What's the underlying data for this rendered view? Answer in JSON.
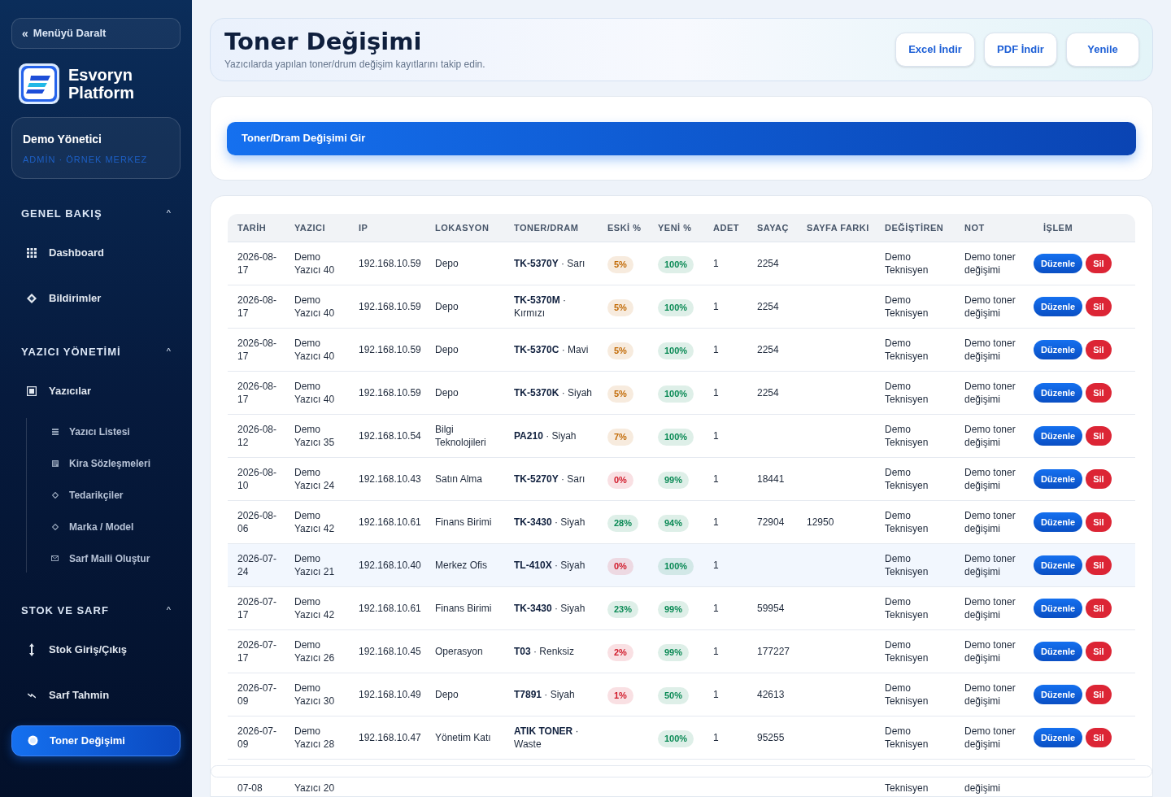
{
  "sidebar": {
    "collapse_button": {
      "icon": "«",
      "label": "Menüyü Daralt"
    },
    "brand": {
      "line1": "Esvoryn",
      "line2": "Platform"
    },
    "user": {
      "name": "Demo Yönetici",
      "role": "ADMİN · ÖRNEK MERKEZ"
    },
    "sections": [
      {
        "title": "GENEL BAKIŞ",
        "toggle": "^",
        "expanded": true,
        "items": [
          {
            "label": "Dashboard",
            "selected": false
          },
          {
            "label": "Bildirimler",
            "selected": false
          }
        ]
      },
      {
        "title": "YAZICI YÖNETİMİ",
        "toggle": "^",
        "expanded": true,
        "items": [
          {
            "label": "Yazıcılar",
            "selected": false,
            "children": [
              {
                "label": "Yazıcı Listesi"
              },
              {
                "label": "Kira Sözleşmeleri"
              },
              {
                "label": "Tedarikçiler"
              },
              {
                "label": "Marka / Model"
              },
              {
                "label": "Sarf Maili Oluştur"
              }
            ]
          }
        ]
      },
      {
        "title": "STOK VE SARF",
        "toggle": "^",
        "expanded": true,
        "items": [
          {
            "label": "Stok Giriş/Çıkış",
            "selected": false
          },
          {
            "label": "Sarf Tahmin",
            "selected": false
          },
          {
            "label": "Toner Değişimi",
            "selected": true
          }
        ]
      }
    ]
  },
  "header": {
    "title": "Toner Değişimi",
    "subtitle": "Yazıcılarda yapılan toner/drum değişim kayıtlarını takip edin.",
    "buttons": [
      "Excel İndir",
      "PDF İndir",
      "Yenile"
    ]
  },
  "entry_button": "Toner/Dram Değişimi Gir",
  "table": {
    "columns": [
      "TARİH",
      "YAZICI",
      "IP",
      "LOKASYON",
      "TONER/DRAM",
      "ESKİ %",
      "YENİ %",
      "ADET",
      "SAYAÇ",
      "SAYFA FARKI",
      "DEĞİŞTİREN",
      "NOT",
      "İŞLEM"
    ],
    "rows": [
      {
        "date": "2026-08-17",
        "printer": "Demo Yazıcı 40",
        "ip": "192.168.10.59",
        "location": "Depo",
        "toner_model": "TK-5370Y",
        "toner_color": "· Sarı",
        "old": {
          "text": "5%",
          "color": "#c26a05"
        },
        "new": {
          "text": "100%",
          "color": "#0a8a55"
        },
        "qty": "1",
        "counter": "2254",
        "changer": "Demo Teknisyen",
        "note": "Demo toner değişimi",
        "actions": [
          "Düzenle",
          "Sil"
        ],
        "highlighted": false
      },
      {
        "date": "2026-08-17",
        "printer": "Demo Yazıcı 40",
        "ip": "192.168.10.59",
        "location": "Depo",
        "toner_model": "TK-5370M",
        "toner_color": "· Kırmızı",
        "old": {
          "text": "5%",
          "color": "#c26a05"
        },
        "new": {
          "text": "100%",
          "color": "#0a8a55"
        },
        "qty": "1",
        "counter": "2254",
        "changer": "Demo Teknisyen",
        "note": "Demo toner değişimi",
        "actions": [
          "Düzenle",
          "Sil"
        ],
        "highlighted": false
      },
      {
        "date": "2026-08-17",
        "printer": "Demo Yazıcı 40",
        "ip": "192.168.10.59",
        "location": "Depo",
        "toner_model": "TK-5370C",
        "toner_color": "· Mavi",
        "old": {
          "text": "5%",
          "color": "#c26a05"
        },
        "new": {
          "text": "100%",
          "color": "#0a8a55"
        },
        "qty": "1",
        "counter": "2254",
        "changer": "Demo Teknisyen",
        "note": "Demo toner değişimi",
        "actions": [
          "Düzenle",
          "Sil"
        ],
        "highlighted": false
      },
      {
        "date": "2026-08-17",
        "printer": "Demo Yazıcı 40",
        "ip": "192.168.10.59",
        "location": "Depo",
        "toner_model": "TK-5370K",
        "toner_color": "· Siyah",
        "old": {
          "text": "5%",
          "color": "#c26a05"
        },
        "new": {
          "text": "100%",
          "color": "#0a8a55"
        },
        "qty": "1",
        "counter": "2254",
        "changer": "Demo Teknisyen",
        "note": "Demo toner değişimi",
        "actions": [
          "Düzenle",
          "Sil"
        ],
        "highlighted": false
      },
      {
        "date": "2026-08-12",
        "printer": "Demo Yazıcı 35",
        "ip": "192.168.10.54",
        "location": "Bilgi Teknolojileri",
        "toner_model": "PA210",
        "toner_color": "· Siyah",
        "old": {
          "text": "7%",
          "color": "#c26a05"
        },
        "new": {
          "text": "100%",
          "color": "#0a8a55"
        },
        "qty": "1",
        "changer": "Demo Teknisyen",
        "note": "Demo toner değişimi",
        "actions": [
          "Düzenle",
          "Sil"
        ],
        "highlighted": false
      },
      {
        "date": "2026-08-10",
        "printer": "Demo Yazıcı 24",
        "ip": "192.168.10.43",
        "location": "Satın Alma",
        "toner_model": "TK-5270Y",
        "toner_color": "· Sarı",
        "old": {
          "text": "0%",
          "color": "#d11a2a"
        },
        "new": {
          "text": "99%",
          "color": "#0a8a55"
        },
        "qty": "1",
        "counter": "18441",
        "changer": "Demo Teknisyen",
        "note": "Demo toner değişimi",
        "actions": [
          "Düzenle",
          "Sil"
        ],
        "highlighted": false
      },
      {
        "date": "2026-08-06",
        "printer": "Demo Yazıcı 42",
        "ip": "192.168.10.61",
        "location": "Finans Birimi",
        "toner_model": "TK-3430",
        "toner_color": "· Siyah",
        "old": {
          "text": "28%",
          "color": "#0a8a55"
        },
        "new": {
          "text": "94%",
          "color": "#0a8a55"
        },
        "qty": "1",
        "counter": "72904",
        "page_diff": "12950",
        "changer": "Demo Teknisyen",
        "note": "Demo toner değişimi",
        "actions": [
          "Düzenle",
          "Sil"
        ],
        "highlighted": false
      },
      {
        "date": "2026-07-24",
        "printer": "Demo Yazıcı 21",
        "ip": "192.168.10.40",
        "location": "Merkez Ofis",
        "toner_model": "TL-410X",
        "toner_color": "· Siyah",
        "old": {
          "text": "0%",
          "color": "#d11a2a"
        },
        "new": {
          "text": "100%",
          "color": "#0a8a55"
        },
        "qty": "1",
        "changer": "Demo Teknisyen",
        "note": "Demo toner değişimi",
        "actions": [
          "Düzenle",
          "Sil"
        ],
        "highlighted": true
      },
      {
        "date": "2026-07-17",
        "printer": "Demo Yazıcı 42",
        "ip": "192.168.10.61",
        "location": "Finans Birimi",
        "toner_model": "TK-3430",
        "toner_color": "· Siyah",
        "old": {
          "text": "23%",
          "color": "#0a8a55"
        },
        "new": {
          "text": "99%",
          "color": "#0a8a55"
        },
        "qty": "1",
        "counter": "59954",
        "changer": "Demo Teknisyen",
        "note": "Demo toner değişimi",
        "actions": [
          "Düzenle",
          "Sil"
        ],
        "highlighted": false
      },
      {
        "date": "2026-07-17",
        "printer": "Demo Yazıcı 26",
        "ip": "192.168.10.45",
        "location": "Operasyon",
        "toner_model": "T03",
        "toner_color": "· Renksiz",
        "old": {
          "text": "2%",
          "color": "#d11a2a"
        },
        "new": {
          "text": "99%",
          "color": "#0a8a55"
        },
        "qty": "1",
        "counter": "177227",
        "changer": "Demo Teknisyen",
        "note": "Demo toner değişimi",
        "actions": [
          "Düzenle",
          "Sil"
        ],
        "highlighted": false
      },
      {
        "date": "2026-07-09",
        "printer": "Demo Yazıcı 30",
        "ip": "192.168.10.49",
        "location": "Depo",
        "toner_model": "T7891",
        "toner_color": "· Siyah",
        "old": {
          "text": "1%",
          "color": "#d11a2a"
        },
        "new": {
          "text": "50%",
          "color": "#0a8a55"
        },
        "qty": "1",
        "counter": "42613",
        "changer": "Demo Teknisyen",
        "note": "Demo toner değişimi",
        "actions": [
          "Düzenle",
          "Sil"
        ],
        "highlighted": false
      },
      {
        "date": "2026-07-09",
        "printer": "Demo Yazıcı 28",
        "ip": "192.168.10.47",
        "location": "Yönetim Katı",
        "toner_model": "ATIK TONER",
        "toner_color": "· Waste",
        "new": {
          "text": "100%",
          "color": "#0a8a55"
        },
        "qty": "1",
        "counter": "95255",
        "changer": "Demo Teknisyen",
        "note": "Demo toner değişimi",
        "actions": [
          "Düzenle",
          "Sil"
        ],
        "highlighted": false
      }
    ],
    "partial_row": {
      "date": "07-08",
      "printer": "Yazıcı 20",
      "changer": "Teknisyen",
      "note": "değişimi"
    }
  }
}
